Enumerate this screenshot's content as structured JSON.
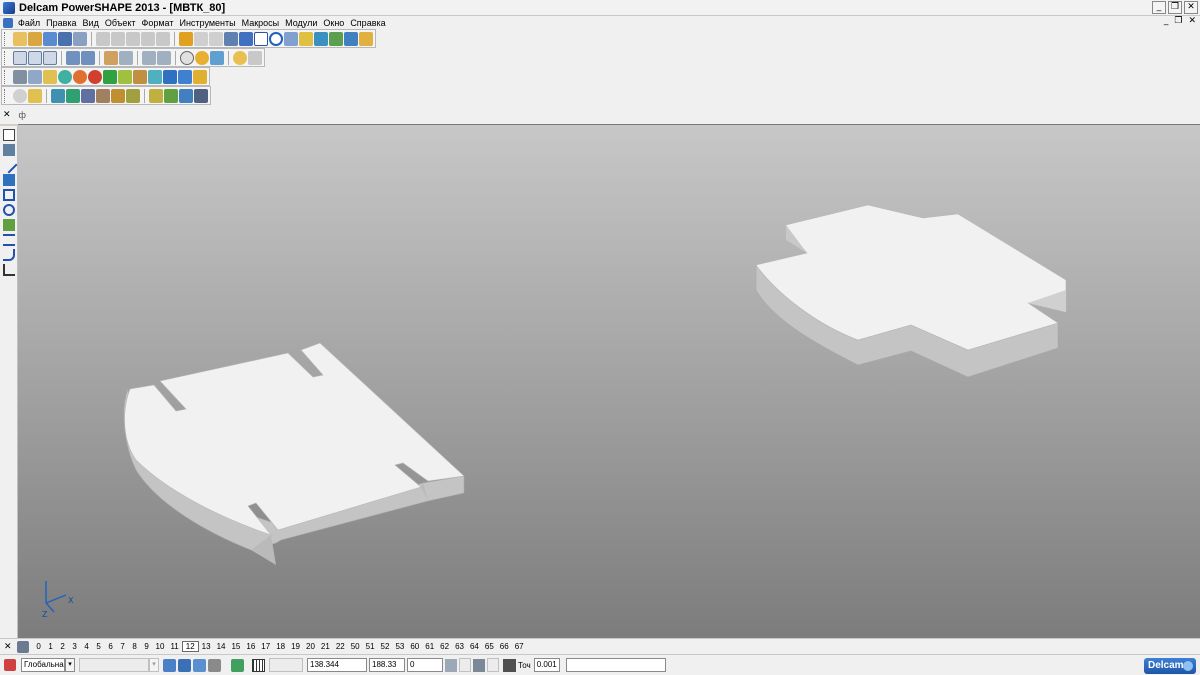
{
  "window": {
    "title": "Delcam PowerSHAPE 2013 - [МВТК_80]",
    "minimize": "_",
    "maximize": "❐",
    "close": "✕"
  },
  "menu": {
    "items": [
      "Файл",
      "Правка",
      "Вид",
      "Объект",
      "Формат",
      "Инструменты",
      "Макросы",
      "Модули",
      "Окно",
      "Справка"
    ],
    "mdi_minimize": "_",
    "mdi_restore": "❐",
    "mdi_close": "✕"
  },
  "toolbar4": {
    "close": "✕",
    "pin": "ф"
  },
  "level_bar": {
    "close": "✕",
    "numbers": [
      "0",
      "1",
      "2",
      "3",
      "4",
      "5",
      "6",
      "7",
      "8",
      "9",
      "10",
      "11",
      "12",
      "13",
      "14",
      "15",
      "16",
      "17",
      "18",
      "19",
      "20",
      "21",
      "22",
      "50",
      "51",
      "52",
      "53",
      "60",
      "61",
      "62",
      "63",
      "64",
      "65",
      "66",
      "67"
    ],
    "active": "12"
  },
  "status": {
    "workplane": "Глобальна",
    "x": "138.344",
    "y": "188.33",
    "z": "0",
    "tolerance_label": "Точ",
    "tolerance": "0.001",
    "logo": "Delcam"
  },
  "axis": {
    "x_label": "X",
    "z_label": "Z"
  }
}
